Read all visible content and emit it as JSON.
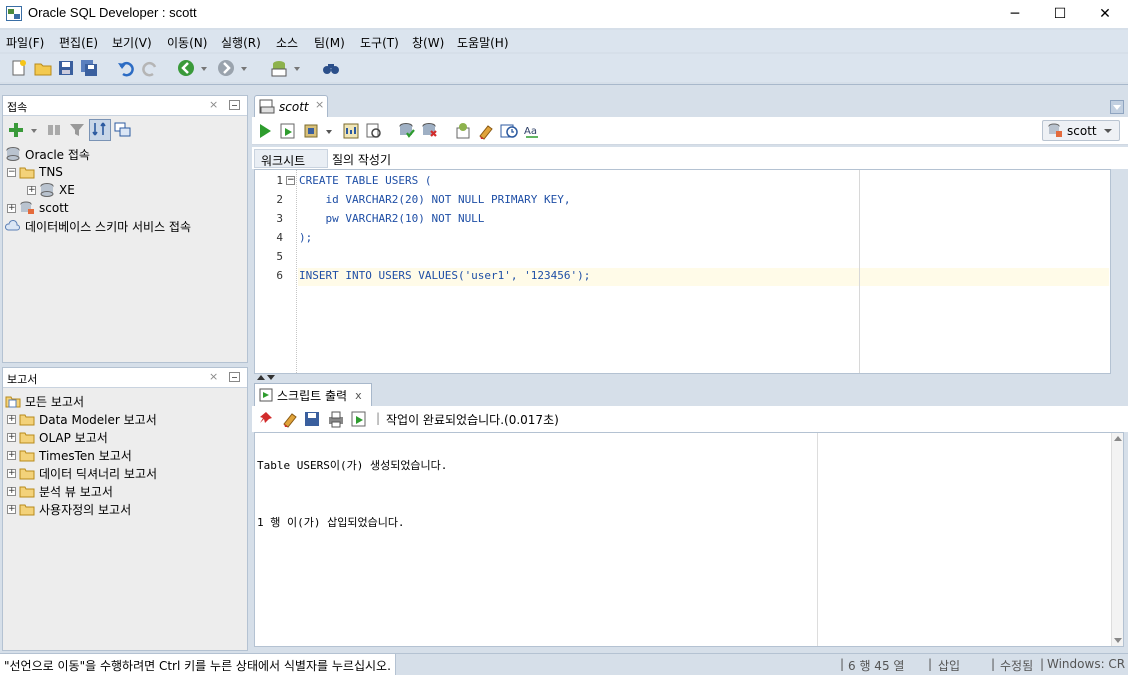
{
  "window": {
    "title": "Oracle SQL Developer : scott",
    "minimize": "─",
    "maximize": "☐",
    "close": "✕"
  },
  "menu": [
    "파일(F)",
    "편집(E)",
    "보기(V)",
    "이동(N)",
    "실행(R)",
    "소스",
    "팀(M)",
    "도구(T)",
    "창(W)",
    "도움말(H)"
  ],
  "connections_panel": {
    "title": "접속",
    "tree": [
      {
        "label": "Oracle 접속",
        "expander": "",
        "icon": "database-icon"
      },
      {
        "label": "TNS",
        "expander": "−",
        "icon": "folder-icon"
      },
      {
        "label": "XE",
        "expander": "+",
        "icon": "database-icon"
      },
      {
        "label": "scott",
        "expander": "+",
        "icon": "connection-icon"
      },
      {
        "label": "데이터베이스 스키마 서비스 접속",
        "expander": "",
        "icon": "cloud-icon"
      }
    ]
  },
  "reports_panel": {
    "title": "보고서",
    "tree": [
      {
        "label": "모든 보고서",
        "expander": "",
        "icon": "reports-icon"
      },
      {
        "label": "Data Modeler 보고서",
        "expander": "+",
        "icon": "folder-icon"
      },
      {
        "label": "OLAP 보고서",
        "expander": "+",
        "icon": "folder-icon"
      },
      {
        "label": "TimesTen 보고서",
        "expander": "+",
        "icon": "folder-icon"
      },
      {
        "label": "데이터 딕셔너리 보고서",
        "expander": "+",
        "icon": "folder-icon"
      },
      {
        "label": "분석 뷰 보고서",
        "expander": "+",
        "icon": "folder-icon"
      },
      {
        "label": "사용자정의 보고서",
        "expander": "+",
        "icon": "folder-icon"
      }
    ]
  },
  "editor": {
    "tab_label": "scott",
    "tab_close": "×",
    "connection": "scott",
    "subtabs": [
      "워크시트",
      "질의 작성기"
    ],
    "lines": [
      {
        "num": "1",
        "code": "CREATE TABLE USERS ("
      },
      {
        "num": "2",
        "code": "    id VARCHAR2(20) NOT NULL PRIMARY KEY,"
      },
      {
        "num": "3",
        "code": "    pw VARCHAR2(10) NOT NULL"
      },
      {
        "num": "4",
        "code": ");"
      },
      {
        "num": "5",
        "code": ""
      },
      {
        "num": "6",
        "code": "INSERT INTO USERS VALUES('user1', '123456');"
      }
    ]
  },
  "output": {
    "tab_label": "스크립트 출력",
    "tab_close": "x",
    "status": "작업이 완료되었습니다.(0.017초)",
    "lines": [
      "Table USERS이(가) 생성되었습니다.",
      "1 행 이(가) 삽입되었습니다."
    ]
  },
  "statusbar": {
    "message": "\"선언으로 이동\"을 수행하려면 Ctrl 키를 누른 상태에서 식별자를 누르십시오.",
    "position": "6 행 45 열",
    "mode": "삽입",
    "state": "수정됨",
    "eol": "Windows: CR"
  }
}
